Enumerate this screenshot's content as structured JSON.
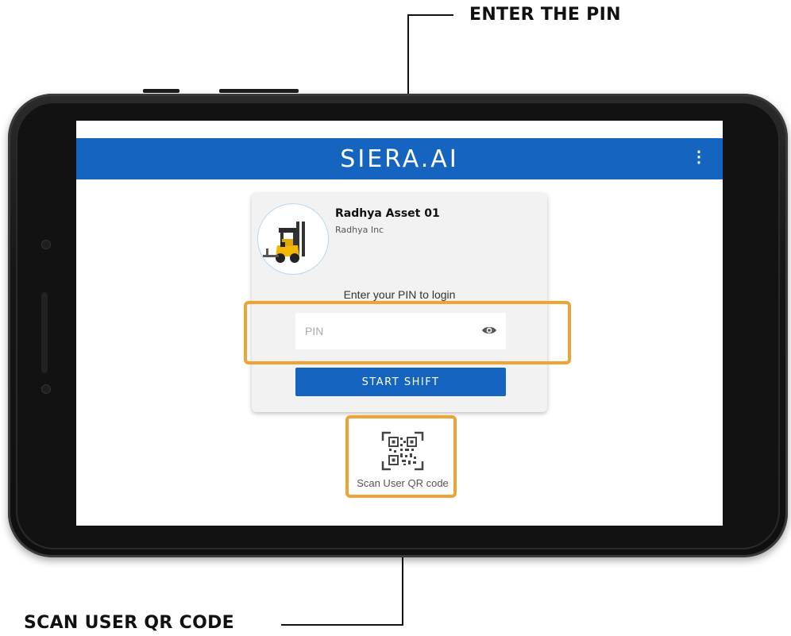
{
  "callouts": {
    "enter_pin": "ENTER THE PIN",
    "scan_qr": "SCAN USER QR CODE"
  },
  "app": {
    "brand": "SIERA.AI",
    "menu_icon": "more-vert-icon",
    "accent_color": "#1565c0",
    "highlight_color": "#f0a233"
  },
  "asset": {
    "name": "Radhya Asset 01",
    "organization": "Radhya Inc",
    "image_icon": "forklift-icon"
  },
  "login": {
    "prompt": "Enter your PIN to login",
    "pin_placeholder": "PIN",
    "pin_value": "",
    "visibility_icon": "eye-icon",
    "start_button": "START SHIFT"
  },
  "qr": {
    "icon": "qr-code-scan-icon",
    "label": "Scan User QR code"
  }
}
